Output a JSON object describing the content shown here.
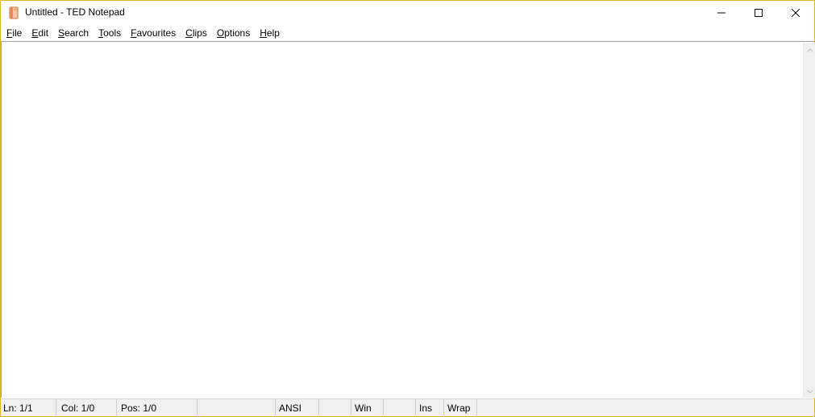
{
  "window": {
    "title": "Untitled - TED Notepad"
  },
  "icons": {
    "app": "notepad-app-icon",
    "minimize": "minimize-icon",
    "maximize": "maximize-icon",
    "close": "close-icon",
    "scroll_up": "scroll-up-arrow-icon",
    "scroll_down": "scroll-down-arrow-icon"
  },
  "menu": [
    {
      "accel": "F",
      "rest": "ile"
    },
    {
      "accel": "E",
      "rest": "dit"
    },
    {
      "accel": "S",
      "rest": "earch"
    },
    {
      "accel": "T",
      "rest": "ools"
    },
    {
      "accel": "F",
      "rest": "avourites"
    },
    {
      "accel": "C",
      "rest": "lips"
    },
    {
      "accel": "O",
      "rest": "ptions"
    },
    {
      "accel": "H",
      "rest": "elp"
    }
  ],
  "editor": {
    "content": ""
  },
  "status": {
    "line": "Ln: 1/1",
    "col": "Col: 1/0",
    "pos": "Pos: 1/0",
    "blank1": "",
    "encoding": "ANSI",
    "blank2": "",
    "eol": "Win",
    "blank3": "",
    "mode": "Ins",
    "wrap": "Wrap"
  },
  "colors": {
    "window_border": "#e6b422",
    "status_bg": "#f0f0f0",
    "scrollbar_bg": "#f0f0f0"
  }
}
